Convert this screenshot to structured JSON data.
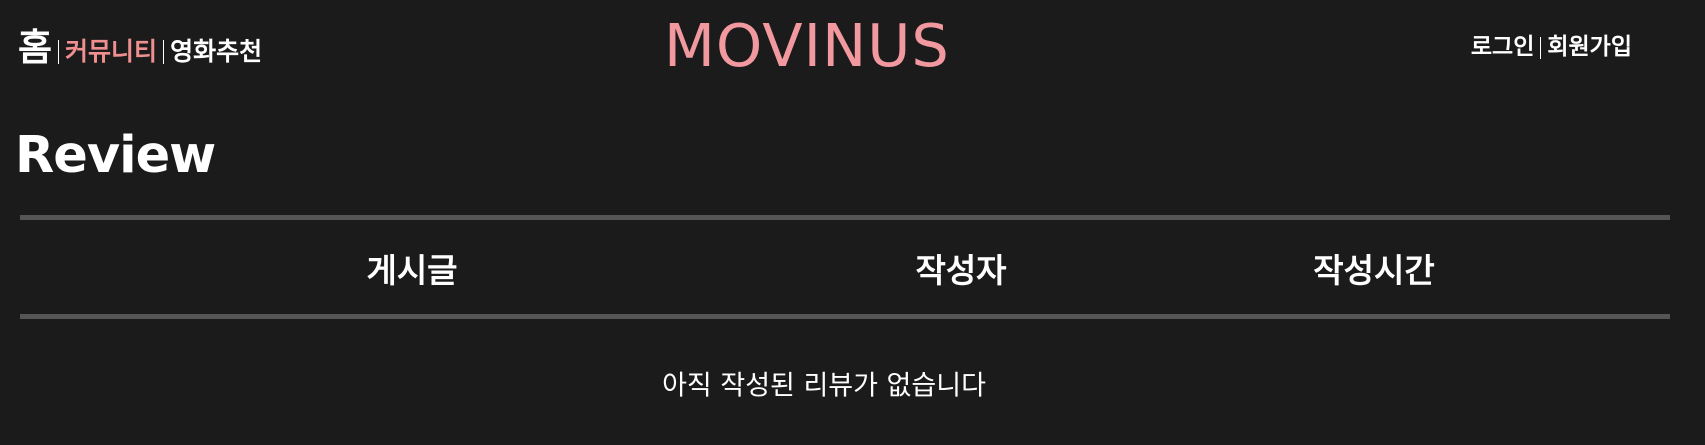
{
  "nav": {
    "home": "홈",
    "community": "커뮤니티",
    "movie_recommend": "영화추천"
  },
  "logo": "MOVINUS",
  "auth": {
    "login": "로그인",
    "signup": "회원가입"
  },
  "page": {
    "title": "Review"
  },
  "table": {
    "columns": [
      "게시글",
      "작성자",
      "작성시간"
    ],
    "empty_message": "아직 작성된 리뷰가 없습니다"
  },
  "colors": {
    "background": "#1b1b1b",
    "accent": "#f08f8f",
    "logo": "#f1999f",
    "divider": "#555555",
    "text": "#ffffff"
  }
}
